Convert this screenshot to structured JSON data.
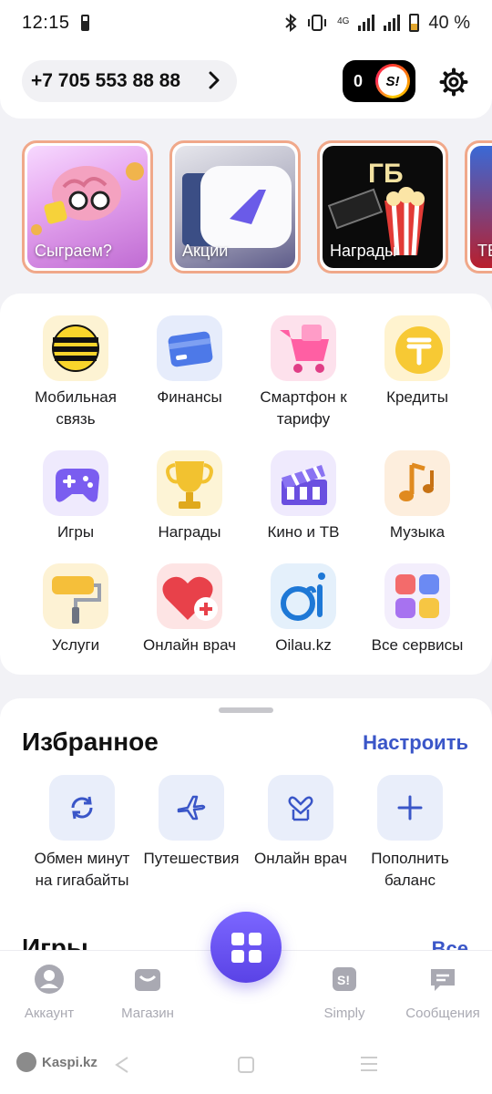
{
  "status_bar": {
    "time": "12:15",
    "network": "4G",
    "battery": "40 %",
    "icons": [
      "battery-saver-icon",
      "bluetooth-icon",
      "vibrate-icon",
      "signal-icon",
      "battery-icon"
    ]
  },
  "header": {
    "phone_number": "+7 705 553 88 88",
    "simply_points": "0",
    "simply_logo": "S!"
  },
  "stories": [
    {
      "label": "Сыграем?",
      "icon": "brain-game-illustration"
    },
    {
      "label": "Акции",
      "icon": "promo-phone-illustration"
    },
    {
      "label": "Награды",
      "icon": "cinema-popcorn-illustration",
      "badge": "ГБ"
    },
    {
      "label": "ТВ",
      "icon": "football-illustration"
    }
  ],
  "services": [
    {
      "label": "Мобильная связь",
      "icon": "beeline-logo-icon"
    },
    {
      "label": "Финансы",
      "icon": "card-icon"
    },
    {
      "label": "Смартфон к тарифу",
      "icon": "cart-icon"
    },
    {
      "label": "Кредиты",
      "icon": "tenge-icon"
    },
    {
      "label": "Игры",
      "icon": "gamepad-icon"
    },
    {
      "label": "Награды",
      "icon": "trophy-icon"
    },
    {
      "label": "Кино и ТВ",
      "icon": "clapperboard-icon"
    },
    {
      "label": "Музыка",
      "icon": "music-note-icon"
    },
    {
      "label": "Услуги",
      "icon": "paint-roller-icon"
    },
    {
      "label": "Онлайн врач",
      "icon": "heart-medical-icon"
    },
    {
      "label": "Oilau.kz",
      "icon": "oilau-logo-icon"
    },
    {
      "label": "Все сервисы",
      "icon": "all-services-icon"
    }
  ],
  "favorites": {
    "title": "Избранное",
    "configure": "Настроить",
    "items": [
      {
        "label": "Обмен минут на гигабайты",
        "icon": "exchange-icon"
      },
      {
        "label": "Путешествия",
        "icon": "airplane-icon"
      },
      {
        "label": "Онлайн врач",
        "icon": "doctor-icon"
      },
      {
        "label": "Пополнить баланс",
        "icon": "plus-icon"
      }
    ]
  },
  "games_section": {
    "title": "Игры",
    "all": "Все"
  },
  "tabbar": [
    {
      "label": "Аккаунт",
      "icon": "account-icon"
    },
    {
      "label": "Магазин",
      "icon": "shop-icon"
    },
    {
      "label": "",
      "icon": "services-grid-icon"
    },
    {
      "label": "Simply",
      "icon": "simply-icon"
    },
    {
      "label": "Сообщения",
      "icon": "messages-icon"
    }
  ],
  "watermark": "Kaspi.kz",
  "colors": {
    "accent": "#3a56c8",
    "center_button": "#6a53f2",
    "story_border": "#f0a88a"
  }
}
